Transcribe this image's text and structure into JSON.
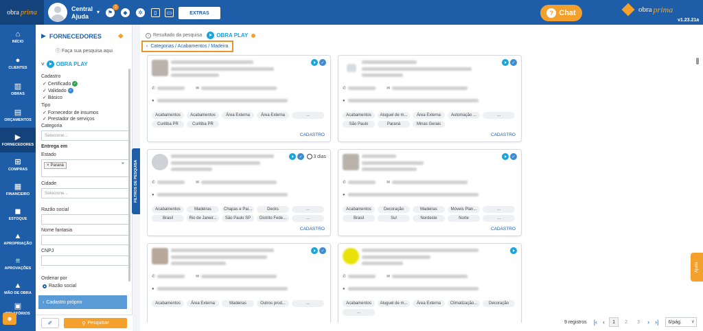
{
  "topbar": {
    "logo_main": "obra",
    "logo_accent": "prima",
    "company_line1": "Central",
    "company_line2": "Ajuda",
    "notification_count": "2",
    "extras_label": "EXTRAS",
    "chat_label": "Chat",
    "brand_main": "obra",
    "brand_accent": "prima",
    "version": "v1.23.21a"
  },
  "nav": {
    "items": [
      {
        "label": "INÍCIO",
        "icon": "home-icon"
      },
      {
        "label": "CLIENTES",
        "icon": "user-icon"
      },
      {
        "label": "OBRAS",
        "icon": "building-icon"
      },
      {
        "label": "ORÇAMENTOS",
        "icon": "budget-icon"
      },
      {
        "label": "FORNECEDORES",
        "icon": "truck-icon"
      },
      {
        "label": "COMPRAS",
        "icon": "cart-icon"
      },
      {
        "label": "FINANCEIRO",
        "icon": "calculator-icon"
      },
      {
        "label": "ESTOQUE",
        "icon": "boxes-icon"
      },
      {
        "label": "APROPRIAÇÃO",
        "icon": "chart-icon"
      },
      {
        "label": "APROVAÇÕES",
        "icon": "checklist-icon"
      },
      {
        "label": "MÃO DE OBRA",
        "icon": "workers-icon"
      },
      {
        "label": "RELATÓRIOS",
        "icon": "report-icon"
      }
    ]
  },
  "filters": {
    "title": "FORNECEDORES",
    "search_hint": "Faça sua pesquisa aqui",
    "obraplay_label": "OBRA PLAY",
    "cadastro_label": "Cadastro",
    "cadastro_options": [
      "Certificado",
      "Validado",
      "Básico"
    ],
    "tipo_label": "Tipo",
    "tipo_options": [
      "Fornecedor de insumos",
      "Prestador de serviços"
    ],
    "categoria_label": "Categoria",
    "categoria_placeholder": "Selecione...",
    "entrega_label": "Entrega em",
    "estado_label": "Estado",
    "estado_chip": "Paraná",
    "cidade_label": "Cidade",
    "cidade_placeholder": "Selecione...",
    "razao_label": "Razão social",
    "fantasia_label": "Nome fantasia",
    "cnpj_label": "CNPJ",
    "ordenar_label": "Ordenar por",
    "ordenar_option": "Razão social",
    "cadastro_proprio": "Cadastro próprio",
    "search_button": "Pesquisar",
    "side_tab": "FILTROS DE PESQUISA"
  },
  "main": {
    "result_label": "Resultado da pesquisa",
    "result_brand": "OBRA PLAY",
    "breadcrumb": "Categorias / Acabamentos / Madeira",
    "cards": [
      {
        "tags": [
          "Acabamentos",
          "Acabamentos",
          "Área Externa",
          "Área Externa",
          "...",
          "Curitiba PR",
          "Curitiba PR"
        ],
        "link": "CADASTRO"
      },
      {
        "tags": [
          "Acabamentos",
          "Aluguel de m...",
          "Área Externa",
          "Automação ...",
          "...",
          "São Paulo",
          "Paraná",
          "Minas Gerais"
        ],
        "link": "CADASTRO"
      },
      {
        "days": "3 dias",
        "tags": [
          "Acabamentos",
          "Madeiras",
          "Chapas e Pai...",
          "Decks",
          "...",
          "Brasil",
          "Rio de Janeir...",
          "São Paulo SP",
          "Distrito Fede...",
          "..."
        ],
        "link": "CADASTRO"
      },
      {
        "tags": [
          "Acabamentos",
          "Decoração",
          "Madeiras",
          "Móveis Plan...",
          "...",
          "Brasil",
          "Sul",
          "Nordeste",
          "Norte",
          "..."
        ],
        "link": "CADASTRO"
      },
      {
        "tags": [
          "Acabamentos",
          "Área Externa",
          "Madeiras",
          "Outros prod...",
          "..."
        ],
        "link": ""
      },
      {
        "tags": [
          "Acabamentos",
          "Aluguel de m...",
          "Área Externa",
          "Climatização...",
          "Decoração",
          "..."
        ],
        "link": ""
      }
    ]
  },
  "help_tab": "Ajuda",
  "pagination": {
    "total": "9 registros",
    "pages": [
      "1",
      "2",
      "3"
    ],
    "page_size": "6/pág."
  }
}
